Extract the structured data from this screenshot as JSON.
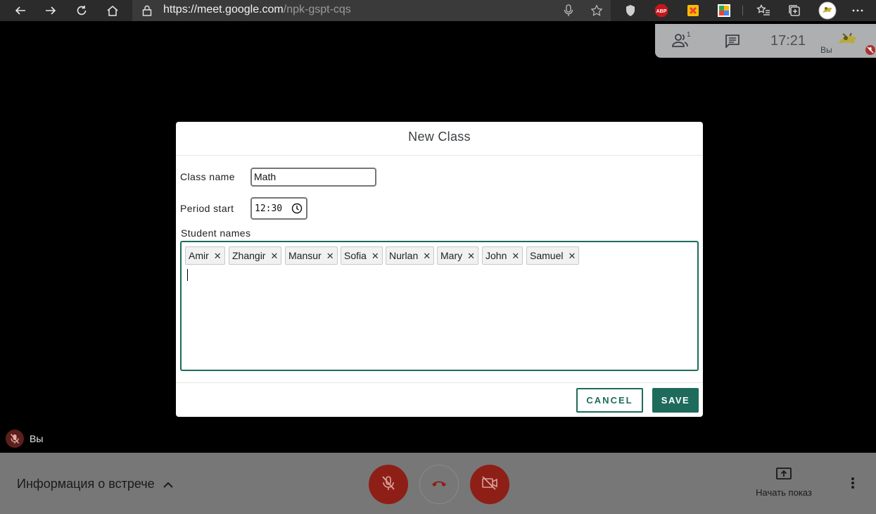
{
  "browser": {
    "url_host": "https://meet.google.com",
    "url_path": "/npk-gspt-cqs",
    "extensions": [
      "shield-icon",
      "adblock-icon",
      "google-workspace-icon",
      "grid-extension-icon"
    ]
  },
  "meet_top": {
    "participants_count": "1",
    "time": "17:21",
    "self_label": "Вы"
  },
  "dialog": {
    "title": "New Class",
    "class_name_label": "Class name",
    "class_name_value": "Math",
    "period_start_label": "Period start",
    "period_start_value": "12:30",
    "student_names_label": "Student names",
    "students": [
      "Amir",
      "Zhangir",
      "Mansur",
      "Sofia",
      "Nurlan",
      "Mary",
      "John",
      "Samuel"
    ],
    "cancel_label": "CANCEL",
    "save_label": "SAVE"
  },
  "self_tile": {
    "name": "Вы"
  },
  "bottom_bar": {
    "meeting_info_label": "Информация о встрече",
    "present_label": "Начать показ"
  },
  "colors": {
    "accent": "#1e6b5c",
    "mute_red": "#8e1f17"
  }
}
